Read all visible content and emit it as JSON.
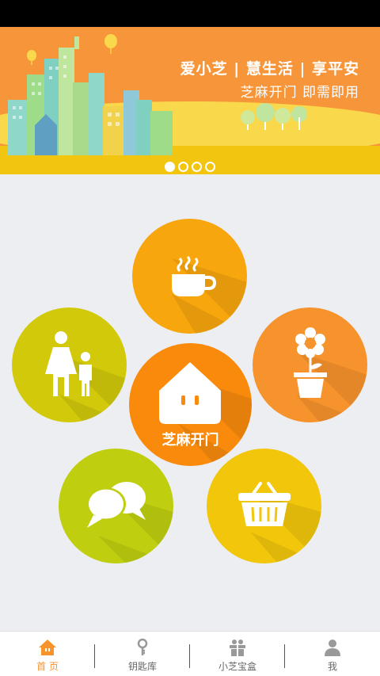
{
  "banner": {
    "title": "爱小芝 | 慧生活 | 享平安",
    "subtitle": "芝麻开门  即需即用",
    "page_count": 4,
    "active_page": 1
  },
  "features": [
    {
      "name": "coffee",
      "icon": "coffee-cup-icon",
      "color": "#f7a60d"
    },
    {
      "name": "family",
      "icon": "family-icon",
      "color": "#d2c90a"
    },
    {
      "name": "flower",
      "icon": "potted-flower-icon",
      "color": "#f7932d"
    },
    {
      "name": "home",
      "icon": "house-icon",
      "color": "#f98a0c",
      "label": "芝麻开门"
    },
    {
      "name": "chat",
      "icon": "chat-bubbles-icon",
      "color": "#bfcf0f"
    },
    {
      "name": "basket",
      "icon": "shopping-basket-icon",
      "color": "#f2c60b"
    }
  ],
  "tabbar": {
    "items": [
      {
        "label": "首 页",
        "icon": "home-icon",
        "active": true
      },
      {
        "label": "钥匙库",
        "icon": "key-icon",
        "active": false
      },
      {
        "label": "小芝宝盒",
        "icon": "gift-box-icon",
        "active": false
      },
      {
        "label": "我",
        "icon": "person-icon",
        "active": false
      }
    ],
    "active_color": "#f7932d",
    "inactive_color": "#666666"
  }
}
